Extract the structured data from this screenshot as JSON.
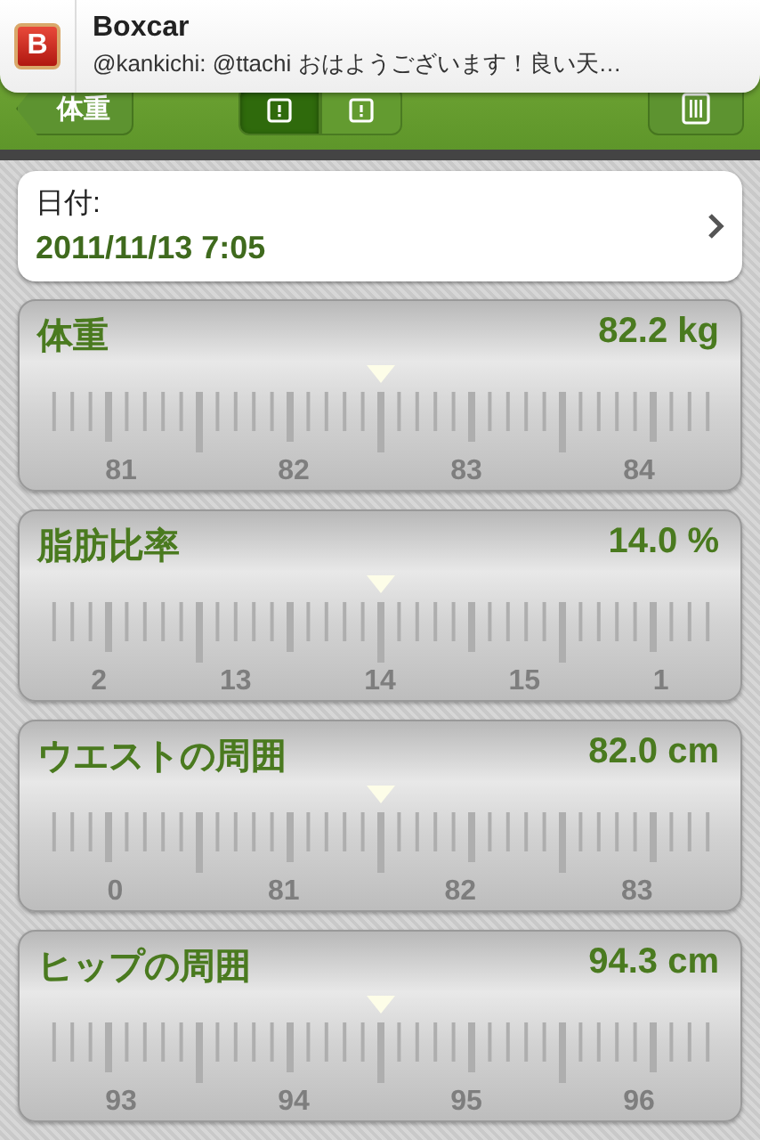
{
  "notification": {
    "app_icon_letter": "B",
    "title": "Boxcar",
    "message": "@kankichi: @ttachi おはようございます！良い天…"
  },
  "nav_bar": {
    "back_button": "体重",
    "segments": [
      {
        "selected": true
      },
      {
        "selected": false
      }
    ]
  },
  "date_row": {
    "label": "日付:",
    "value": "2011/11/13 7:05"
  },
  "measurements": [
    {
      "name": "体重",
      "reading": "82.2 kg",
      "scale": [
        "81",
        "82",
        "83",
        "84"
      ]
    },
    {
      "name": "脂肪比率",
      "reading": "14.0 %",
      "scale": [
        "2",
        "13",
        "14",
        "15",
        "1"
      ]
    },
    {
      "name": "ウエストの周囲",
      "reading": "82.0 cm",
      "scale": [
        "0",
        "81",
        "82",
        "83"
      ]
    },
    {
      "name": "ヒップの周囲",
      "reading": "94.3 cm",
      "scale": [
        "93",
        "94",
        "95",
        "96"
      ]
    }
  ]
}
